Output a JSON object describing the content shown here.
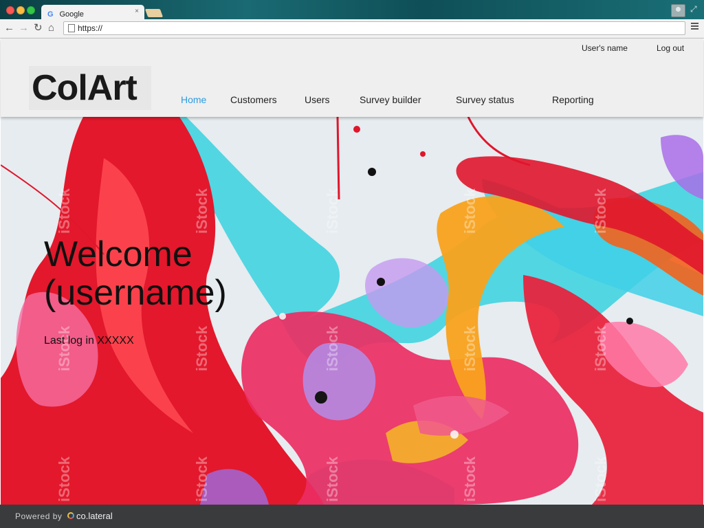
{
  "browser": {
    "tab_title": "Google",
    "tab_favicon": "G",
    "tab_close": "×",
    "url": "https://",
    "icons": [
      "back-arrow-icon",
      "forward-arrow-icon",
      "reload-icon",
      "home-icon",
      "page-icon",
      "menu-icon",
      "profile-icon"
    ]
  },
  "header": {
    "user_name": "User's name",
    "logout": "Log out",
    "logo": "ColArt",
    "nav": [
      {
        "label": "Home",
        "active": true
      },
      {
        "label": "Customers",
        "active": false
      },
      {
        "label": "Users",
        "active": false
      },
      {
        "label": "Survey builder",
        "active": false
      },
      {
        "label": "Survey status",
        "active": false
      },
      {
        "label": "Reporting",
        "active": false
      }
    ],
    "active_color": "#2b9be0"
  },
  "hero": {
    "welcome_line1": "Welcome",
    "welcome_line2": "(username)",
    "last_log": "Last log in XXXXX",
    "watermark": "iStock",
    "colors": [
      "#e8162f",
      "#43d6e2",
      "#f7a21a",
      "#b085e0",
      "#f36aa0"
    ]
  },
  "footer": {
    "powered_by": "Powered by",
    "brand": "co.lateral"
  }
}
